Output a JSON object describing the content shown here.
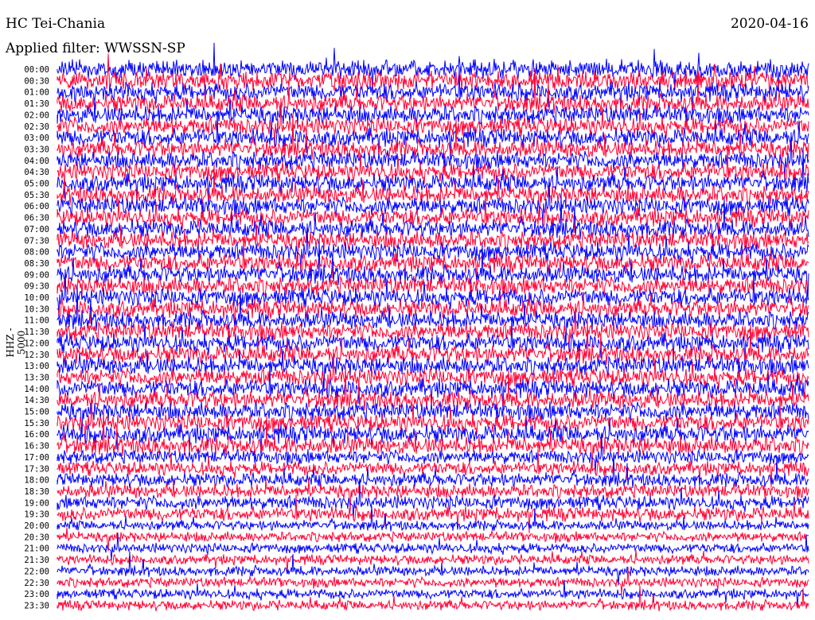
{
  "header": {
    "station": "HC Tei-Chania",
    "date": "2020-04-16",
    "filter": "Applied filter: WWSSN-SP"
  },
  "chart_data": {
    "type": "line",
    "title": "HC Tei-Chania",
    "ylabel": "HHZ - 5000",
    "row_labels": [
      "00:00",
      "00:30",
      "01:00",
      "01:30",
      "02:00",
      "02:30",
      "03:00",
      "03:30",
      "04:00",
      "04:30",
      "05:00",
      "05:30",
      "06:00",
      "06:30",
      "07:00",
      "07:30",
      "08:00",
      "08:30",
      "09:00",
      "09:30",
      "10:00",
      "10:30",
      "11:00",
      "11:30",
      "12:00",
      "12:30",
      "13:00",
      "13:30",
      "14:00",
      "14:30",
      "15:00",
      "15:30",
      "16:00",
      "16:30",
      "17:00",
      "17:30",
      "18:00",
      "18:30",
      "19:00",
      "19:30",
      "20:00",
      "20:30",
      "21:00",
      "21:30",
      "22:00",
      "22:30",
      "23:00",
      "23:30"
    ],
    "trace_colors": [
      "#0000ff",
      "#ff0033"
    ],
    "grid": false
  }
}
